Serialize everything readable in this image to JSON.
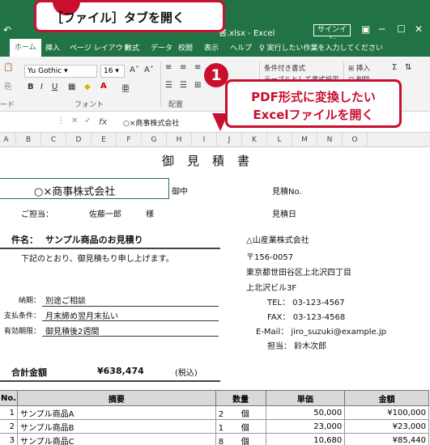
{
  "excel": {
    "title": "書.xlsx - Excel",
    "signin": "サインイン",
    "tabs": [
      "ホーム",
      "挿入",
      "ページ レイアウト",
      "数式",
      "データ",
      "校閲",
      "表示",
      "ヘルプ"
    ],
    "tell_me": "実行したい作業を入力してください",
    "ribbon": {
      "font_name": "Yu Gothic",
      "font_size": "16",
      "group_clipboard": "ード",
      "group_font": "フォント",
      "group_alignment": "配置",
      "conditional_format": "条件付き書式",
      "table_format": "テーブルとして書式設定",
      "insert": "挿入",
      "delete": "削除"
    },
    "formula_content": "○×商事株式会社",
    "columns": [
      "A",
      "B",
      "C",
      "D",
      "E",
      "F",
      "G",
      "H",
      "I",
      "J",
      "K",
      "L",
      "M",
      "N",
      "O"
    ]
  },
  "sheet": {
    "doc_title": "御見積書",
    "addressee": "○×商事株式会社",
    "onchu": "御中",
    "contact_label": "ご担当：",
    "contact_name": "佐藤一郎",
    "sama": "様",
    "quote_no_label": "見積No.",
    "quote_date_label": "見積日",
    "subject_label": "件名：",
    "subject": "サンプル商品のお見積り",
    "intro": "下記のとおり、御見積もり申し上げます。",
    "company": "△山産業株式会社",
    "postal": "〒156-0057",
    "addr1": "東京都世田谷区上北沢四丁目",
    "addr2": "上北沢ビル3F",
    "tel": "TEL： 03-123-4567",
    "fax": "FAX： 03-123-4568",
    "email": "E-Mail： jiro_suzuki@example.jp",
    "staff": "担当： 鈴木次郎",
    "delivery_label": "納期：",
    "delivery": "別途ご相談",
    "payment_label": "支払条件：",
    "payment": "月末締め翌月末払い",
    "validity_label": "有効期限：",
    "validity": "御見積後2週間",
    "total_label": "合計金額",
    "total": "¥638,474",
    "tax_note": "(税込)",
    "table_headers": [
      "No.",
      "摘要",
      "数量",
      "単価",
      "金額"
    ],
    "rows": [
      {
        "no": "1",
        "desc": "サンプル商品A",
        "qty": "2",
        "unit": "個",
        "price": "50,000",
        "amount": "¥100,000"
      },
      {
        "no": "2",
        "desc": "サンプル商品B",
        "qty": "1",
        "unit": "個",
        "price": "23,000",
        "amount": "¥23,000"
      },
      {
        "no": "3",
        "desc": "サンプル商品C",
        "qty": "8",
        "unit": "個",
        "price": "10,680",
        "amount": "¥85,440"
      }
    ]
  },
  "annotations": {
    "step_open_file": "［ファイル］タブを開く",
    "step1_badge": "1",
    "step1_line1": "PDF形式に変換したい",
    "step1_line2": "Excelファイルを開く"
  },
  "colors": {
    "excel_green": "#217346",
    "annotation_red": "#c8102e",
    "table_header_bg": "#d9d9d9"
  }
}
